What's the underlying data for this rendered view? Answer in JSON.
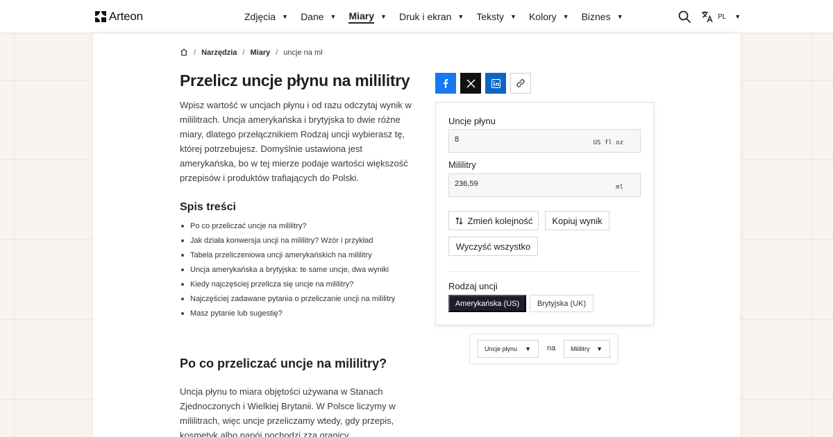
{
  "brand": {
    "name": "Arteon"
  },
  "nav": {
    "items": [
      {
        "label": "Zdjęcia"
      },
      {
        "label": "Dane"
      },
      {
        "label": "Miary",
        "active": true
      },
      {
        "label": "Druk i ekran"
      },
      {
        "label": "Teksty"
      },
      {
        "label": "Kolory"
      },
      {
        "label": "Biznes"
      }
    ],
    "search_icon": "search-icon",
    "language": {
      "code": "PL",
      "icon": "translate-icon"
    }
  },
  "breadcrumb": {
    "home_icon": "home-icon",
    "items": [
      "Narzędzia",
      "Miary",
      "uncje na ml"
    ]
  },
  "page": {
    "title": "Przelicz uncje płynu na mililitry",
    "intro": "Wpisz wartość w uncjach płynu i od razu odczytaj wynik w mililitrach. Uncja amerykańska i brytyjska to dwie różne miary, dlatego przełącznikiem Rodzaj uncji wybierasz tę, której potrzebujesz. Domyślnie ustawiona jest amerykańska, bo w tej mierze podaje wartości większość przepisów i produktów trafiających do Polski.",
    "toc_title": "Spis treści",
    "toc": [
      "Po co przeliczać uncje na mililitry?",
      "Jak działa konwersja uncji na mililitry? Wzór i przykład",
      "Tabela przeliczeniowa uncji amerykańskich na mililitry",
      "Uncja amerykańska a brytyjska: te same uncje, dwa wyniki",
      "Kiedy najczęściej przelicza się uncje na mililitry?",
      "Najczęściej zadawane pytania o przeliczanie uncji na mililitry",
      "Masz pytanie lub sugestię?"
    ],
    "section_title": "Po co przeliczać uncje na mililitry?",
    "section_text": "Uncja płynu to miara objętości używana w Stanach Zjednoczonych i Wielkiej Brytanii. W Polsce liczymy w mililitrach, więc uncje przeliczamy wtedy, gdy przepis, kosmetyk albo napój pochodzi zza granicy. Najczęściej"
  },
  "share": {
    "buttons": [
      {
        "name": "facebook",
        "icon": "facebook-icon",
        "color": "#1877f2"
      },
      {
        "name": "x",
        "icon": "x-icon",
        "color": "#111111"
      },
      {
        "name": "linkedin",
        "icon": "linkedin-icon",
        "color": "#0a66c2"
      },
      {
        "name": "copy-link",
        "icon": "link-icon"
      }
    ]
  },
  "converter": {
    "input_label": "Uncje płynu",
    "input_value": "8",
    "input_unit": "US fl oz",
    "output_label": "Mililitry",
    "output_value": "236,59",
    "output_unit": "ml",
    "swap_label": "Zmień kolejność",
    "copy_label": "Kopiuj wynik",
    "clear_label": "Wyczyść wszystko",
    "type_label": "Rodzaj uncji",
    "type_options": [
      "Amerykańska (US)",
      "Brytyjska (UK)"
    ],
    "type_selected": "Amerykańska (US)"
  },
  "selector": {
    "from": "Uncje płynu",
    "connector": "na",
    "to": "Mililitry"
  },
  "colors": {
    "accent_dark": "#1c1f2b",
    "background": "#f8f4f0"
  }
}
